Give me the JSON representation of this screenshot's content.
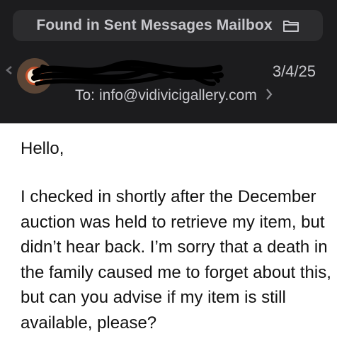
{
  "banner": {
    "title": "Found in Sent Messages Mailbox",
    "icon": "folder-icon"
  },
  "message": {
    "sender_name": "[redacted]",
    "date": "3/4/25",
    "to_label": "To:",
    "to_address": "info@vidivicigallery.com",
    "greeting": "Hello,",
    "body": "I checked in shortly after the December auction was held to retrieve my item, but didn’t hear back. I’m sorry that a death in the family caused me to forget about this, but can you advise if my item is still available, please?"
  },
  "colors": {
    "header_bg": "#1c1c1e",
    "banner_bg": "#2c2c2e",
    "header_text": "#c7c7cc",
    "body_bg": "#ffffff",
    "body_text": "#111111"
  }
}
